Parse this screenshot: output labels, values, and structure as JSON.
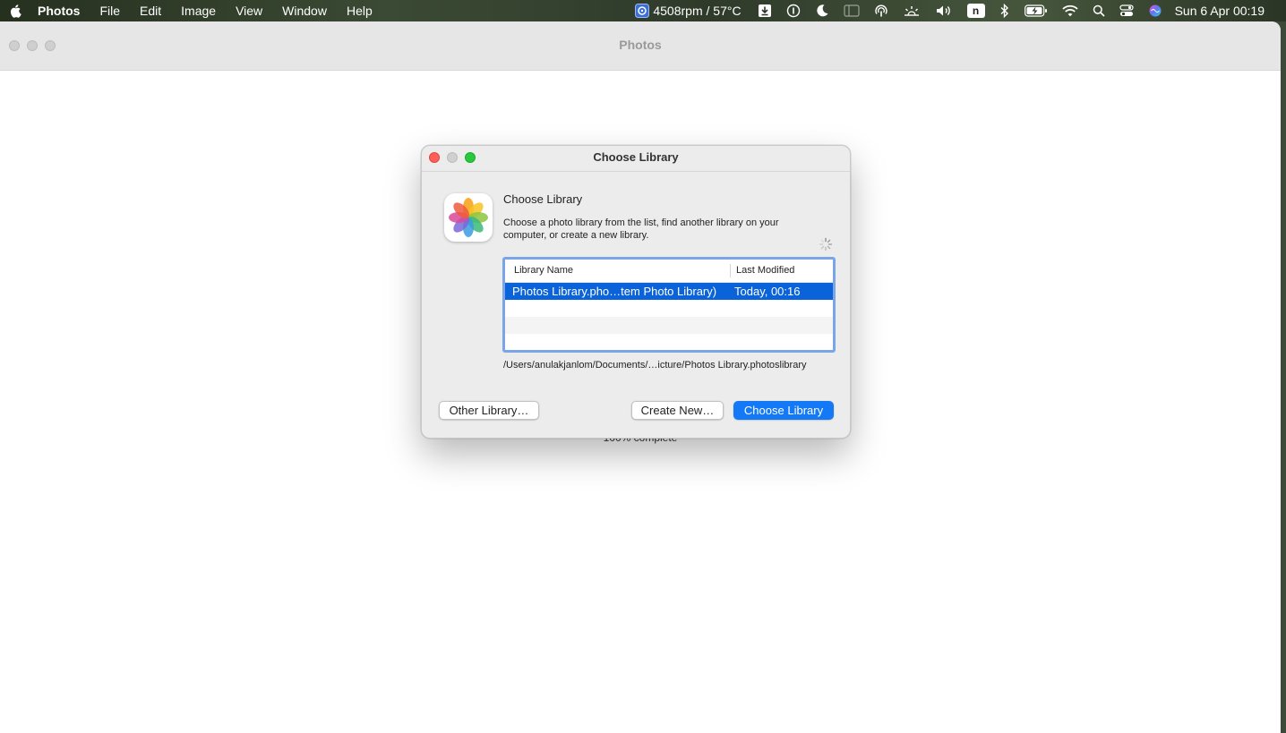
{
  "menubar": {
    "app_name": "Photos",
    "menus": [
      "File",
      "Edit",
      "Image",
      "View",
      "Window",
      "Help"
    ],
    "fan_status": "4508rpm / 57°C",
    "input_indicator": "n",
    "clock": "Sun 6 Apr  00:19"
  },
  "main_window": {
    "title": "Photos",
    "progress_text": "100% complete"
  },
  "dialog": {
    "title": "Choose Library",
    "heading": "Choose Library",
    "description": "Choose a photo library from the list, find another library on your computer, or create a new library.",
    "table": {
      "columns": [
        "Library Name",
        "Last Modified"
      ],
      "rows": [
        {
          "name": "Photos Library.pho…tem Photo Library)",
          "modified": "Today, 00:16",
          "selected": true
        }
      ]
    },
    "path": "/Users/anulakjanlom/Documents/…icture/Photos Library.photoslibrary",
    "buttons": {
      "other": "Other Library…",
      "create": "Create New…",
      "choose": "Choose Library"
    }
  },
  "colors": {
    "accent": "#1479f7",
    "selection": "#0a63d8",
    "close": "#ff5f57",
    "minimize": "#d0d0d0",
    "zoom": "#28c840"
  }
}
